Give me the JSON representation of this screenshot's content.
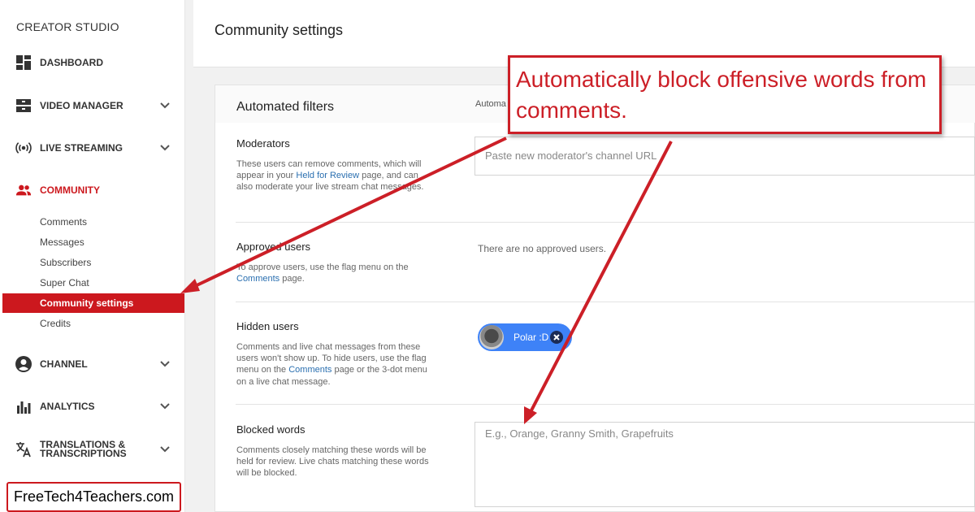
{
  "sidebar": {
    "brand": "CREATOR STUDIO",
    "nav": [
      {
        "label": "DASHBOARD",
        "icon": "dashboard-icon",
        "has_chevron": false
      },
      {
        "label": "VIDEO MANAGER",
        "icon": "video-manager-icon",
        "has_chevron": true
      },
      {
        "label": "LIVE STREAMING",
        "icon": "live-streaming-icon",
        "has_chevron": true
      },
      {
        "label": "COMMUNITY",
        "icon": "community-icon",
        "has_chevron": false,
        "active": true
      },
      {
        "label": "CHANNEL",
        "icon": "channel-icon",
        "has_chevron": true
      },
      {
        "label": "ANALYTICS",
        "icon": "analytics-icon",
        "has_chevron": true
      },
      {
        "label": "TRANSLATIONS & TRANSCRIPTIONS",
        "icon": "translate-icon",
        "has_chevron": true
      }
    ],
    "community_sub": [
      "Comments",
      "Messages",
      "Subscribers",
      "Super Chat",
      "Community settings",
      "Credits"
    ],
    "selected_sub": "Community settings",
    "accent_color": "#cc181e"
  },
  "header": {
    "title": "Community settings"
  },
  "card": {
    "title": "Automated filters",
    "auto_label": "Automa",
    "moderators": {
      "title": "Moderators",
      "desc_before": "These users can remove comments, which will appear in your ",
      "desc_link": "Held for Review",
      "desc_after": " page, and can also moderate your live stream chat messages.",
      "input_placeholder": "Paste new moderator's channel URL"
    },
    "approved": {
      "title": "Approved users",
      "desc_before": "To approve users, use the flag menu on the ",
      "desc_link": "Comments",
      "desc_after": " page.",
      "empty_text": "There are no approved users."
    },
    "hidden": {
      "title": "Hidden users",
      "desc_before": "Comments and live chat messages from these users won't show up. To hide users, use the flag menu on the ",
      "desc_link": "Comments",
      "desc_after": " page or the 3-dot menu on a live chat message.",
      "chip_label": "Polar :D",
      "chip_color": "#3e82f7"
    },
    "blocked": {
      "title": "Blocked words",
      "desc": "Comments closely matching these words will be held for review. Live chats matching these words will be blocked.",
      "input_placeholder": "E.g., Orange, Granny Smith, Grapefruits"
    }
  },
  "callout": {
    "text": "Automatically block offensive words from comments.",
    "color": "#cc1f27"
  },
  "watermark": "FreeTech4Teachers.com"
}
